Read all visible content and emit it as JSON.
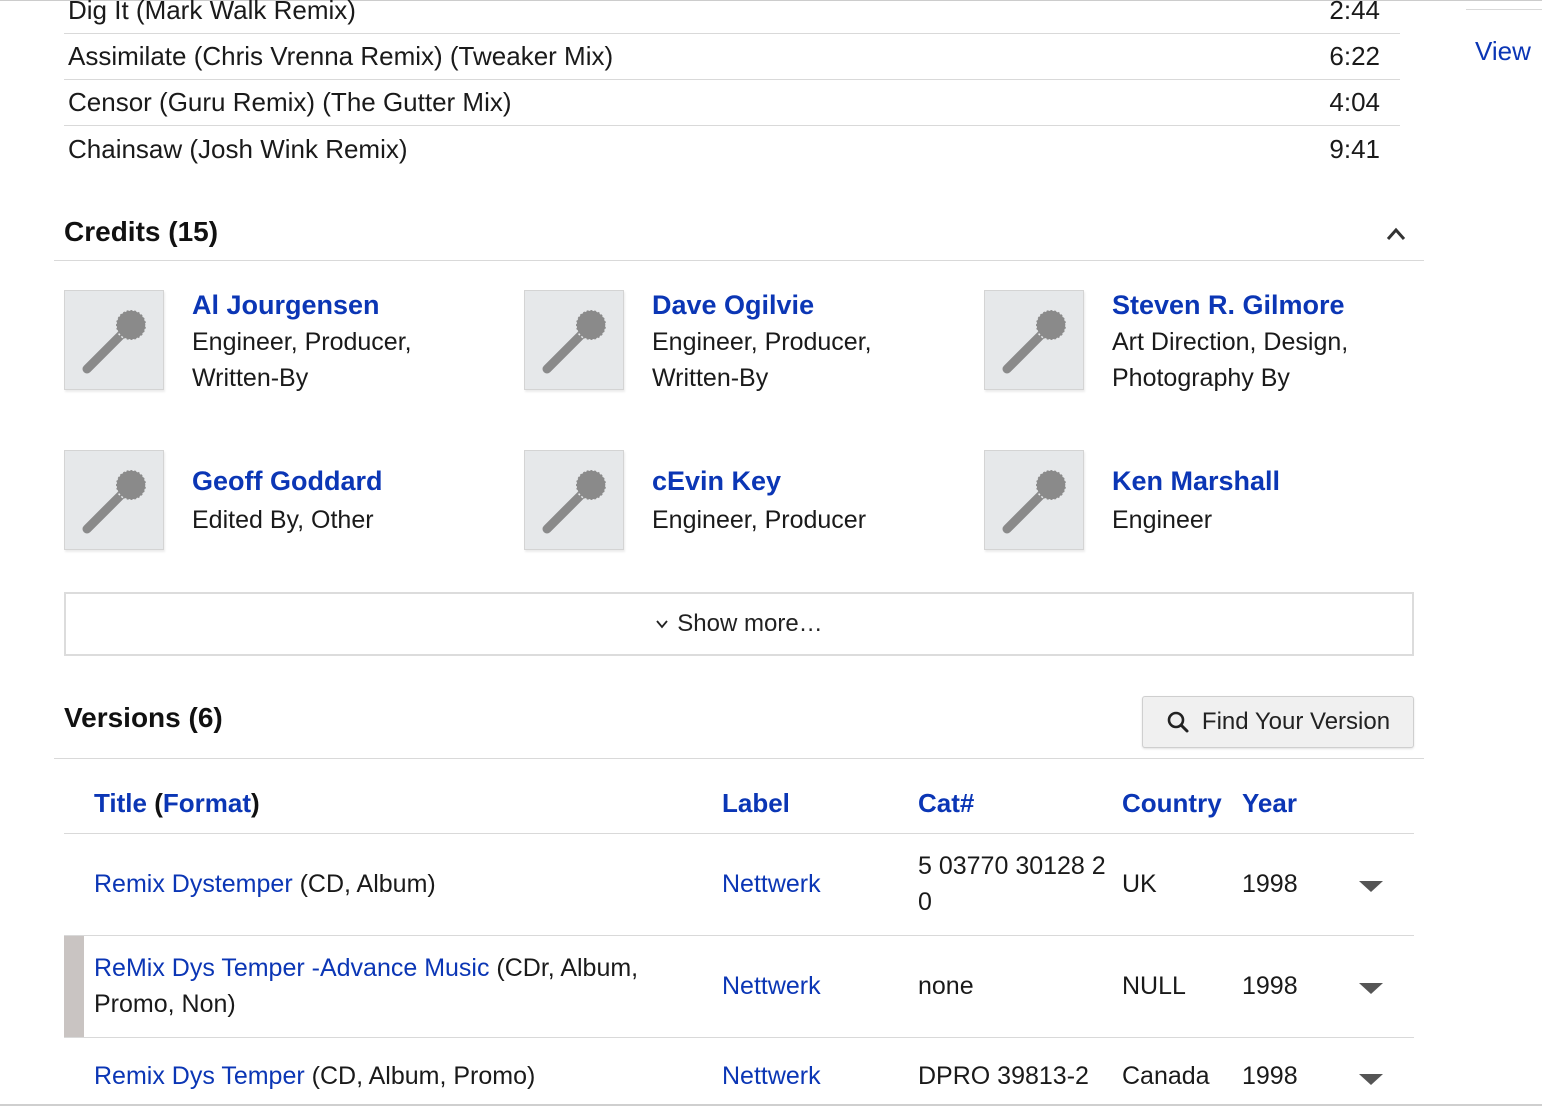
{
  "tracks": [
    {
      "title": "Dig It (Mark Walk Remix)",
      "duration": "2:44"
    },
    {
      "title": "Assimilate (Chris Vrenna Remix) (Tweaker Mix)",
      "duration": "6:22"
    },
    {
      "title": "Censor (Guru Remix) (The Gutter Mix)",
      "duration": "4:04"
    },
    {
      "title": "Chainsaw (Josh Wink Remix)",
      "duration": "9:41"
    }
  ],
  "side": {
    "view_label": "View"
  },
  "credits": {
    "title": "Credits (15)",
    "items": [
      {
        "name": "Al Jourgensen",
        "roles": "Engineer, Producer, Written-By"
      },
      {
        "name": "Dave Ogilvie",
        "roles": "Engineer, Producer, Written-By"
      },
      {
        "name": "Steven R. Gilmore",
        "roles": "Art Direction, Design, Photography By"
      },
      {
        "name": "Geoff Goddard",
        "roles": "Edited By, Other"
      },
      {
        "name": "cEvin Key",
        "roles": "Engineer, Producer"
      },
      {
        "name": "Ken Marshall",
        "roles": "Engineer"
      }
    ],
    "show_more": "Show more…"
  },
  "versions": {
    "title": "Versions (6)",
    "find_button": "Find Your Version",
    "headers": {
      "title": "Title",
      "open_paren": " (",
      "format": "Format",
      "close_paren": ")",
      "label": "Label",
      "cat": "Cat#",
      "country": "Country",
      "year": "Year"
    },
    "rows": [
      {
        "title": "Remix Dystemper",
        "format": " (CD, Album)",
        "label": "Nettwerk",
        "cat": "5 03770 30128 2 0",
        "country": "UK",
        "year": "1998"
      },
      {
        "title": "ReMix Dys Temper -Advance Music",
        "format": " (CDr, Album, Promo, Non)",
        "label": "Nettwerk",
        "cat": "none",
        "country": "NULL",
        "year": "1998"
      },
      {
        "title": "Remix Dys Temper",
        "format": " (CD, Album, Promo)",
        "label": "Nettwerk",
        "cat": "DPRO 39813-2",
        "country": "Canada",
        "year": "1998"
      }
    ]
  },
  "colors": {
    "link": "#0b36b5",
    "marker": "#c9c4c2",
    "thumb_bg": "#e6e8ea"
  }
}
